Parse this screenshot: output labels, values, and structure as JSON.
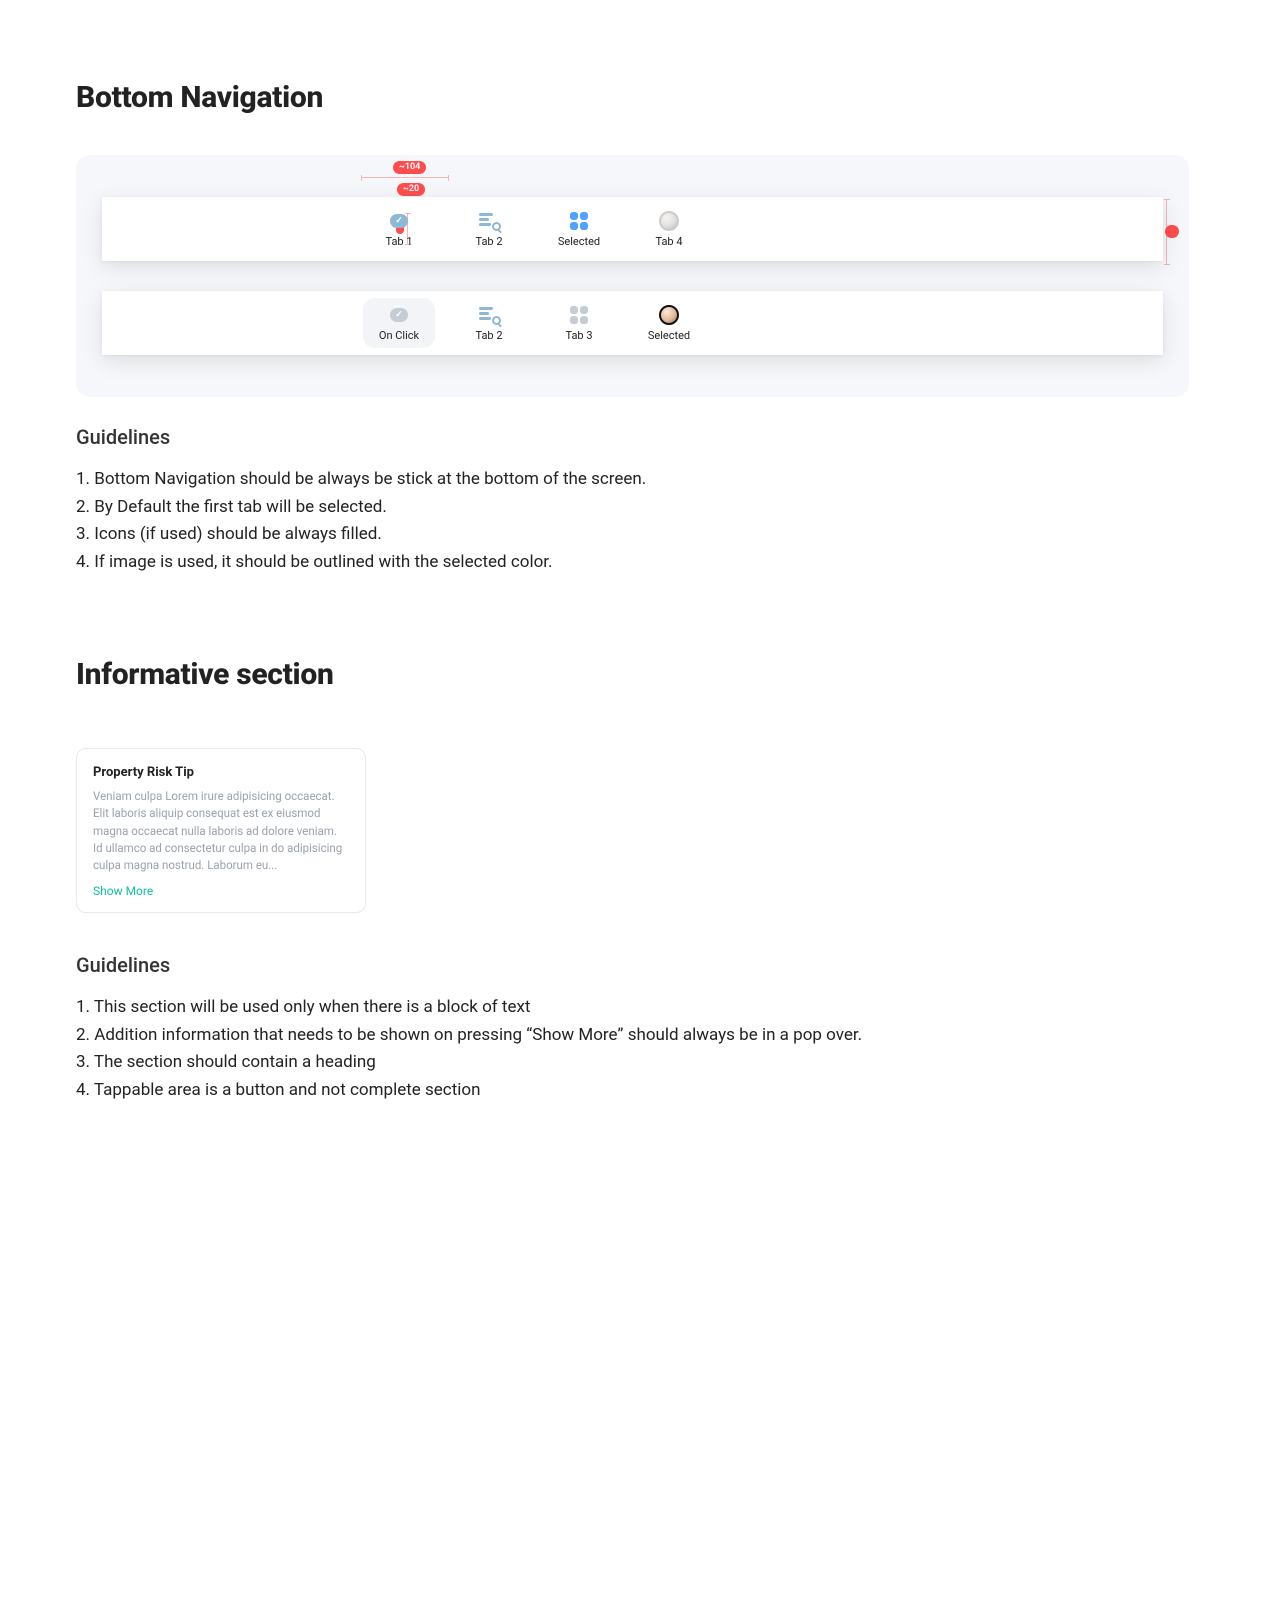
{
  "sections": {
    "bottom_nav": {
      "heading": "Bottom Navigation",
      "measure_wide": "~104",
      "measure_narrow": "~20",
      "measure_height": "",
      "row1": {
        "tab1": "Tab 1",
        "tab2": "Tab 2",
        "tab3": "Selected",
        "tab4": "Tab 4"
      },
      "row2": {
        "tab1": "On Click",
        "tab2": "Tab 2",
        "tab3": "Tab 3",
        "tab4": "Selected"
      },
      "guidelines_heading": "Guidelines",
      "guidelines": [
        "1. Bottom Navigation should be always be stick at the bottom of the screen.",
        "2. By Default the first tab will be selected.",
        "3. Icons (if used) should be always filled.",
        "4. If image is used, it should be outlined with the selected color."
      ]
    },
    "informative": {
      "heading": "Informative section",
      "card": {
        "title": "Property Risk Tip",
        "body": "Veniam culpa Lorem irure adipisicing occaecat. Elit laboris aliquip consequat est ex eiusmod magna occaecat nulla laboris ad dolore veniam. Id ullamco ad consectetur culpa in do adipisicing culpa magna nostrud. Laborum eu...",
        "show_more": "Show More"
      },
      "guidelines_heading": "Guidelines",
      "guidelines": [
        "1. This section will be used only when there is a block of text",
        "2. Addition information that needs to be shown on pressing “Show More” should always be in a pop over.",
        "3. The section should contain a heading",
        "4. Tappable area is a button and not complete section"
      ]
    }
  }
}
